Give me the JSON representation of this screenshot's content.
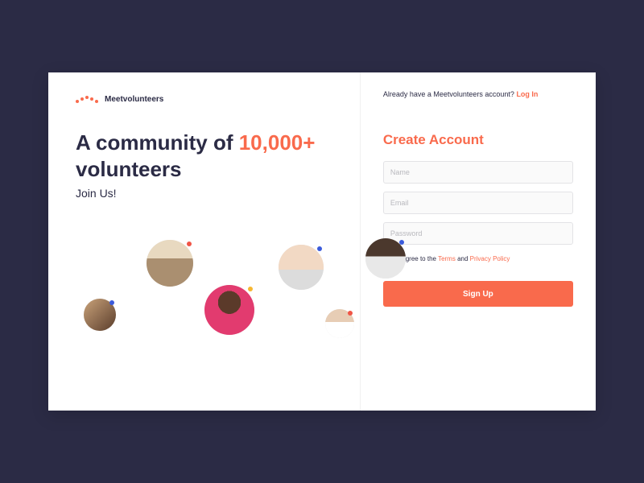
{
  "brand": "Meetvolunteers",
  "headline_prefix": "A community of ",
  "headline_accent": "10,000+",
  "headline_suffix": " volunteers",
  "subheadline": "Join Us!",
  "login_prompt": "Already have a Meetvolunteers account? ",
  "login_link": "Log In",
  "form": {
    "title": "Create Account",
    "name_placeholder": "Name",
    "email_placeholder": "Email",
    "password_placeholder": "Password",
    "agree_prefix": "I agree to the ",
    "terms": "Terms",
    "agree_mid": " and ",
    "privacy": "Privacy Policy",
    "submit": "Sign Up"
  }
}
